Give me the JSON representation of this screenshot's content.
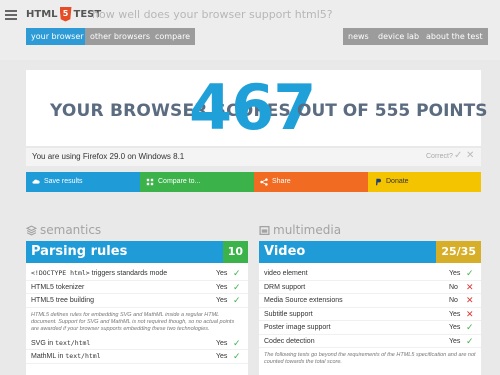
{
  "header": {
    "logo_left": "HTML",
    "logo_num": "5",
    "logo_right": "TEST",
    "tagline": "how well does your browser support html5?"
  },
  "nav": {
    "your_browser": "your browser",
    "other_browsers": "other browsers",
    "compare": "compare",
    "news": "news",
    "device_lab": "device lab",
    "about": "about the test"
  },
  "score": {
    "prefix": "YOUR BROWSER SCORES",
    "value": "467",
    "suffix": "OUT OF 555 POINTS"
  },
  "browser_info": {
    "text": "You are using Firefox 29.0 on Windows 8.1",
    "correct_label": "Correct?",
    "yes_icon": "✓",
    "no_icon": "✕"
  },
  "share_bar": {
    "save": "Save results",
    "compare": "Compare to...",
    "share": "Share",
    "donate": "Donate"
  },
  "categories": {
    "semantics": "semantics",
    "multimedia": "multimedia"
  },
  "parsing": {
    "title": "Parsing rules",
    "score": "10",
    "rows": [
      {
        "prefix": "<!DOCTYPE html>",
        "label": " triggers standards mode",
        "value": "Yes"
      },
      {
        "prefix": "",
        "label": "HTML5 tokenizer",
        "value": "Yes"
      },
      {
        "prefix": "",
        "label": "HTML5 tree building",
        "value": "Yes"
      }
    ],
    "note": "HTML5 defines rules for embedding SVG and MathML inside a regular HTML document. Support for SVG and MathML is not required though, so no actual points are awarded if your browser supports embedding these two technologies.",
    "extra_rows": [
      {
        "prefix": "SVG in ",
        "code": "text/html",
        "value": "Yes"
      },
      {
        "prefix": "MathML in ",
        "code": "text/html",
        "value": "Yes"
      }
    ]
  },
  "video": {
    "title": "Video",
    "score": "25/35",
    "rows": [
      {
        "label": "video element",
        "value": "Yes",
        "ok": true
      },
      {
        "label": "DRM support",
        "value": "No",
        "ok": false
      },
      {
        "label": "Media Source extensions",
        "value": "No",
        "ok": false
      },
      {
        "label": "Subtitle support",
        "value": "Yes",
        "ok": true
      },
      {
        "label": "Poster image support",
        "value": "Yes",
        "ok": true
      },
      {
        "label": "Codec detection",
        "value": "Yes",
        "ok": true
      }
    ],
    "note": "The following tests go beyond the requirements of the HTML5 specification and are not counted towards the total score."
  },
  "colors": {
    "accent": "#2e9bd6",
    "green": "#3bb34a",
    "orange": "#f26b22",
    "yellow": "#f5c400",
    "gold": "#d7ae28"
  }
}
